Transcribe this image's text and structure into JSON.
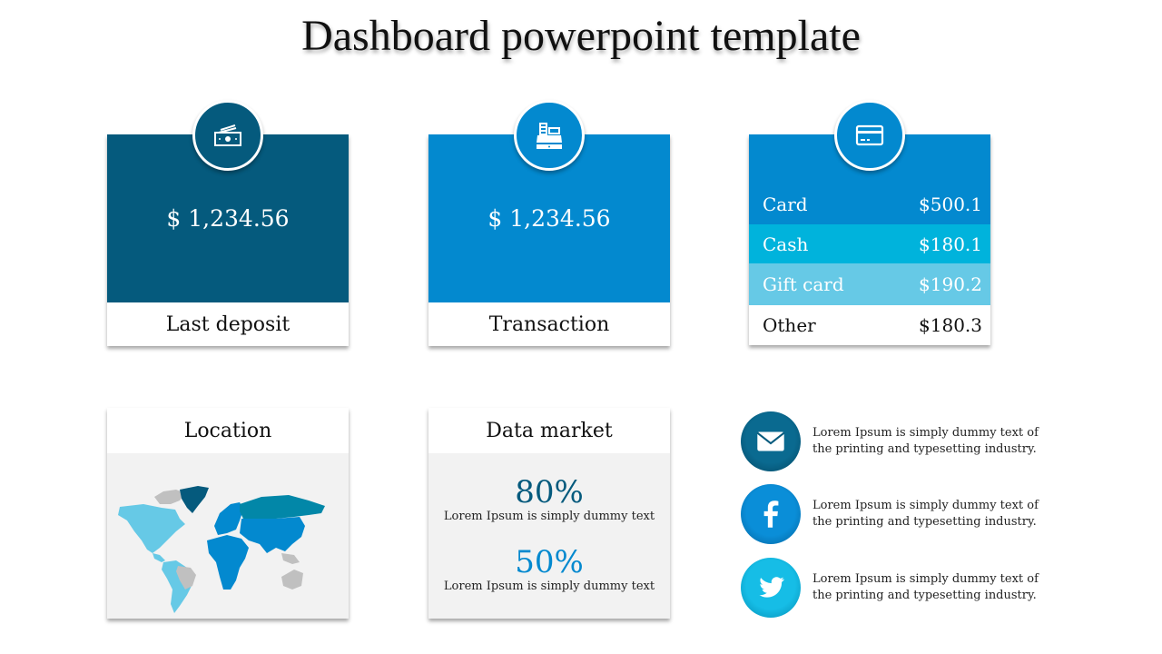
{
  "title": "Dashboard powerpoint template",
  "colors": {
    "dark_blue": "#055a7d",
    "mid_blue": "#0389cf",
    "cyan": "#00b3dc",
    "light_cyan": "#66c9e6",
    "panel_bg": "#f2f2f2"
  },
  "cards": {
    "last_deposit": {
      "amount": "$ 1,234.56",
      "label": "Last deposit",
      "icon": "money-bills-icon"
    },
    "transaction": {
      "amount": "$ 1,234.56",
      "label": "Transaction",
      "icon": "cash-register-icon"
    },
    "payments": {
      "icon": "credit-card-icon",
      "rows": [
        {
          "label": "Card",
          "value": "$500.1"
        },
        {
          "label": "Cash",
          "value": "$180.1"
        },
        {
          "label": "Gift card",
          "value": "$190.2"
        },
        {
          "label": "Other",
          "value": "$180.3"
        }
      ]
    }
  },
  "location": {
    "title": "Location",
    "map": "world-map"
  },
  "data_market": {
    "title": "Data market",
    "stats": [
      {
        "value": "80%",
        "desc": "Lorem Ipsum is simply dummy text"
      },
      {
        "value": "50%",
        "desc": "Lorem Ipsum is simply dummy text"
      }
    ]
  },
  "social": [
    {
      "icon": "mail-icon",
      "text": "Lorem Ipsum is simply dummy text of the printing and typesetting industry."
    },
    {
      "icon": "facebook-icon",
      "text": "Lorem Ipsum is simply dummy text of the printing and typesetting industry."
    },
    {
      "icon": "twitter-icon",
      "text": "Lorem Ipsum is simply dummy text of the printing and typesetting industry."
    }
  ]
}
